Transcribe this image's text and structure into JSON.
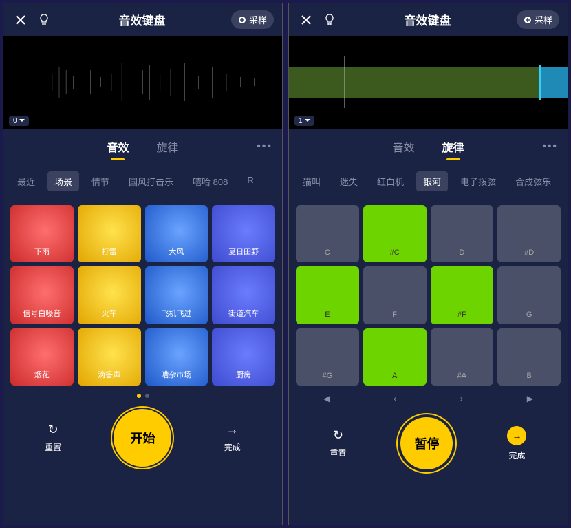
{
  "left": {
    "header_title": "音效键盘",
    "sample_btn": "采样",
    "track_number": "0",
    "main_tabs": [
      {
        "label": "音效",
        "active": true
      },
      {
        "label": "旋律",
        "active": false
      }
    ],
    "categories": [
      {
        "label": "最近",
        "active": false
      },
      {
        "label": "场景",
        "active": true
      },
      {
        "label": "情节",
        "active": false
      },
      {
        "label": "国风打击乐",
        "active": false
      },
      {
        "label": "嘻哈 808",
        "active": false
      },
      {
        "label": "R",
        "active": false
      }
    ],
    "pads": [
      {
        "label": "下雨",
        "color": "radial-gradient(circle at 55% 45%, #ff6e6e, #cc2b2b)"
      },
      {
        "label": "打雷",
        "color": "radial-gradient(circle at 55% 45%, #ffe24d, #e2a500)"
      },
      {
        "label": "大风",
        "color": "radial-gradient(circle at 55% 45%, #6aa3ff, #1e59c9)"
      },
      {
        "label": "夏日田野",
        "color": "radial-gradient(circle at 55% 45%, #6b7cff, #3e4bce)"
      },
      {
        "label": "信号白噪音",
        "color": "radial-gradient(circle at 55% 45%, #ff6e6e, #cc2b2b)"
      },
      {
        "label": "火车",
        "color": "radial-gradient(circle at 55% 45%, #ffe24d, #e2a500)"
      },
      {
        "label": "飞机飞过",
        "color": "radial-gradient(circle at 55% 45%, #6aa3ff, #1e59c9)"
      },
      {
        "label": "街道汽车",
        "color": "radial-gradient(circle at 55% 45%, #6b7cff, #3e4bce)"
      },
      {
        "label": "烟花",
        "color": "radial-gradient(circle at 55% 45%, #ff6e6e, #cc2b2b)"
      },
      {
        "label": "滴答声",
        "color": "radial-gradient(circle at 55% 45%, #ffe24d, #e2a500)"
      },
      {
        "label": "嘈杂市场",
        "color": "radial-gradient(circle at 55% 45%, #6aa3ff, #1e59c9)"
      },
      {
        "label": "厨房",
        "color": "radial-gradient(circle at 55% 45%, #6b7cff, #3e4bce)"
      }
    ],
    "page_dots": [
      true,
      false
    ],
    "reset_label": "重置",
    "play_label": "开始",
    "done_label": "完成"
  },
  "right": {
    "header_title": "音效键盘",
    "sample_btn": "采样",
    "track_number": "1",
    "main_tabs": [
      {
        "label": "音效",
        "active": false
      },
      {
        "label": "旋律",
        "active": true
      }
    ],
    "categories": [
      {
        "label": "猫叫",
        "active": false
      },
      {
        "label": "迷失",
        "active": false
      },
      {
        "label": "红白机",
        "active": false
      },
      {
        "label": "银河",
        "active": true
      },
      {
        "label": "电子拨弦",
        "active": false
      },
      {
        "label": "合成弦乐",
        "active": false
      }
    ],
    "notes": [
      {
        "label": "C",
        "lit": false
      },
      {
        "label": "#C",
        "lit": true
      },
      {
        "label": "D",
        "lit": false
      },
      {
        "label": "#D",
        "lit": false
      },
      {
        "label": "E",
        "lit": true
      },
      {
        "label": "F",
        "lit": false
      },
      {
        "label": "#F",
        "lit": true
      },
      {
        "label": "G",
        "lit": false
      },
      {
        "label": "#G",
        "lit": false
      },
      {
        "label": "A",
        "lit": true
      },
      {
        "label": "#A",
        "lit": false
      },
      {
        "label": "B",
        "lit": false
      }
    ],
    "reset_label": "重置",
    "play_label": "暂停",
    "done_label": "完成"
  }
}
